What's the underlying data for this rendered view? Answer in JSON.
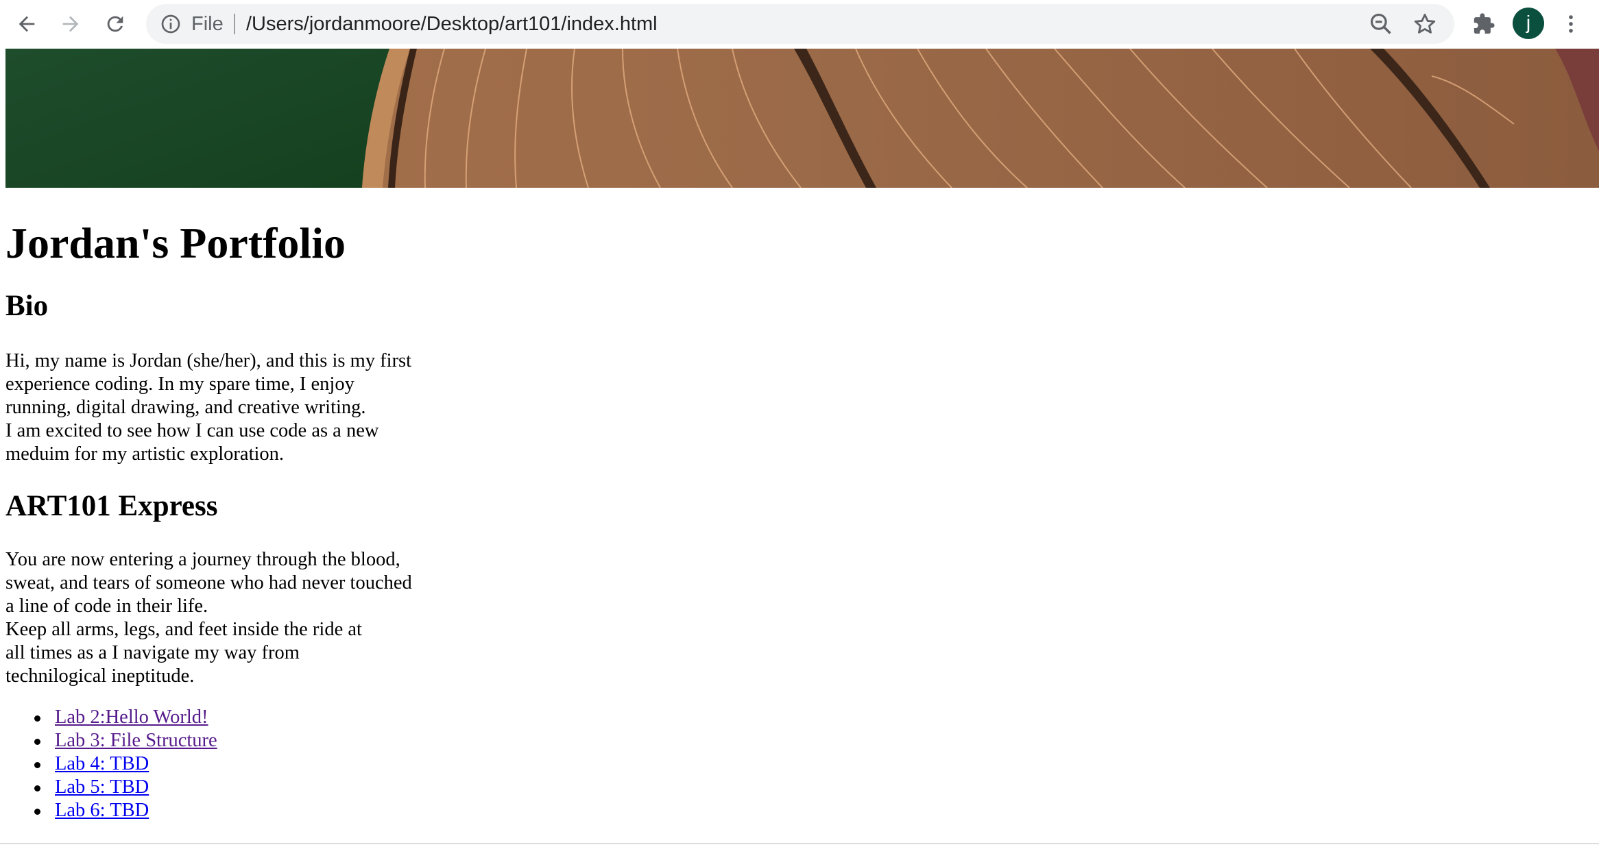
{
  "browser": {
    "scheme_label": "File",
    "url": "/Users/jordanmoore/Desktop/art101/index.html",
    "profile_initial": "j",
    "icons": {
      "back": "arrow-left-icon",
      "forward": "arrow-right-icon",
      "reload": "reload-icon",
      "info": "info-icon",
      "zoom": "zoom-out-icon",
      "bookmark": "star-icon",
      "extensions": "puzzle-icon",
      "menu": "kebab-menu-icon"
    },
    "colors": {
      "avatar": "#0b4f3f",
      "omnibox": "#f1f3f4"
    }
  },
  "page": {
    "title": "Jordan's Portfolio",
    "bio_heading": "Bio",
    "bio_lines": [
      "Hi, my name is Jordan (she/her), and this is my first",
      "experience coding. In my spare time, I enjoy",
      "running, digital drawing, and creative writing.",
      "I am excited to see how I can use code as a new",
      "meduim for my artistic exploration."
    ],
    "express_heading": "ART101 Express",
    "express_lines": [
      "You are now entering a journey through the blood,",
      "sweat, and tears of someone who had never touched",
      "a line of code in their life.",
      "Keep all arms, legs, and feet inside the ride at",
      "all times as a I navigate my way from",
      "technilogical ineptitude."
    ],
    "links": [
      {
        "label": "Lab 2:Hello World!",
        "visited": true
      },
      {
        "label": "Lab 3: File Structure",
        "visited": true
      },
      {
        "label": "Lab 4: TBD",
        "visited": false
      },
      {
        "label": "Lab 5: TBD",
        "visited": false
      },
      {
        "label": "Lab 6: TBD",
        "visited": false
      }
    ],
    "colors": {
      "link_visited": "#551a8b",
      "link_unvisited": "#0000ee"
    }
  }
}
